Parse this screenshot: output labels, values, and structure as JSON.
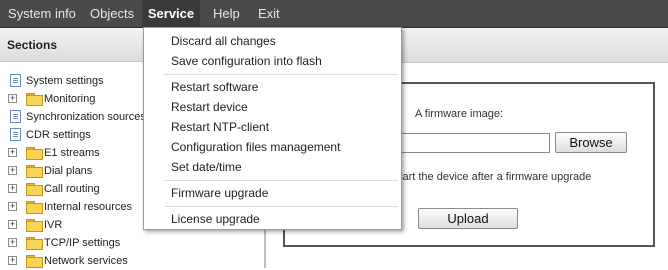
{
  "menubar": {
    "items": [
      "System info",
      "Objects",
      "Service",
      "Help",
      "Exit"
    ],
    "active": "Service"
  },
  "service_menu": {
    "items": [
      "Discard all changes",
      "Save configuration into flash",
      "Restart software",
      "Restart device",
      "Restart NTP-client",
      "Configuration files management",
      "Set date/time",
      "Firmware upgrade",
      "License upgrade"
    ]
  },
  "sidebar": {
    "title": "Sections",
    "tree": [
      "System settings",
      "Monitoring",
      "Synchronization sources",
      "CDR settings",
      "E1 streams",
      "Dial plans",
      "Call routing",
      "Internal resources",
      "IVR",
      "TCP/IP settings",
      "Network services"
    ]
  },
  "firmware": {
    "label": "A firmware image:",
    "input_value": "d",
    "browse_label": "Browse",
    "note": "ally restart the device after a firmware upgrade",
    "upload_label": "Upload"
  }
}
